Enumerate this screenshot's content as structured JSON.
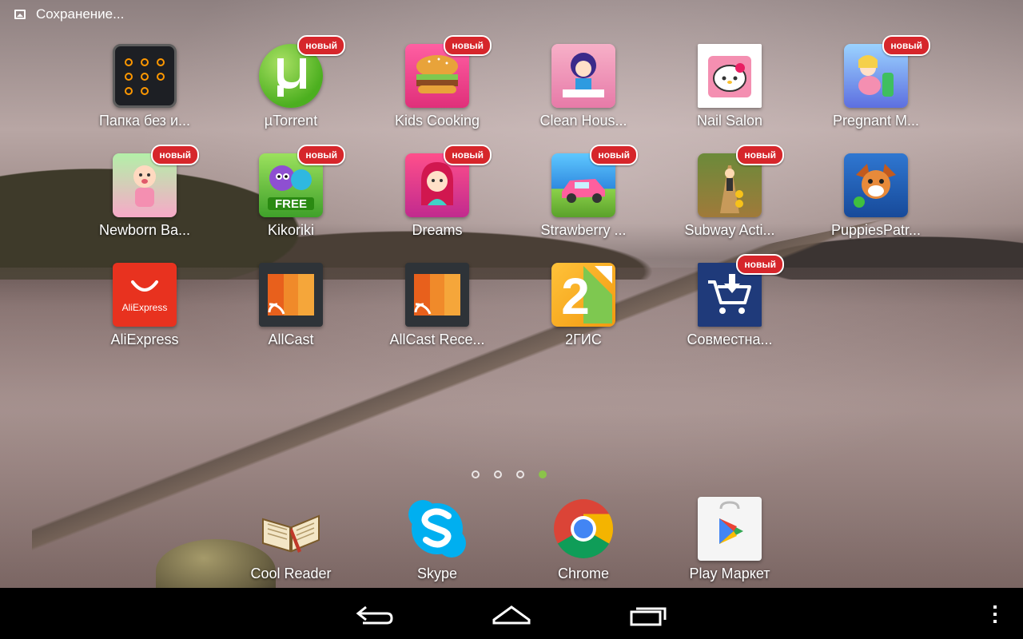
{
  "status_bar": {
    "notification_text": "Сохранение...",
    "notification_icon": "image-icon"
  },
  "badge_text": "новый",
  "apps": [
    {
      "label": "Папка без и...",
      "icon": "folder-icon",
      "badge": false
    },
    {
      "label": "µTorrent",
      "icon": "utorrent-icon",
      "badge": true
    },
    {
      "label": "Kids Cooking",
      "icon": "burger-game-icon",
      "badge": true
    },
    {
      "label": "Clean Hous...",
      "icon": "clean-house-game-icon",
      "badge": false
    },
    {
      "label": "Nail Salon",
      "icon": "hello-kitty-nail-icon",
      "badge": false
    },
    {
      "label": "Pregnant M...",
      "icon": "pregnant-game-icon",
      "badge": true
    },
    {
      "label": "Newborn Ba...",
      "icon": "newborn-baby-icon",
      "badge": true
    },
    {
      "label": "Kikoriki",
      "icon": "kikoriki-icon",
      "badge": true
    },
    {
      "label": "Dreams",
      "icon": "strawberry-dreams-icon",
      "badge": true
    },
    {
      "label": "Strawberry ...",
      "icon": "strawberry-car-icon",
      "badge": true
    },
    {
      "label": "Subway Acti...",
      "icon": "subway-runner-icon",
      "badge": true
    },
    {
      "label": "PuppiesPatr...",
      "icon": "puppy-patrol-icon",
      "badge": false
    },
    {
      "label": "AliExpress",
      "icon": "aliexpress-icon",
      "badge": false
    },
    {
      "label": "AllCast",
      "icon": "allcast-icon",
      "badge": false
    },
    {
      "label": "AllCast Rece...",
      "icon": "allcast-receiver-icon",
      "badge": false
    },
    {
      "label": "2ГИС",
      "icon": "2gis-icon",
      "badge": false
    },
    {
      "label": "Совместна...",
      "icon": "shopping-cart-icon",
      "badge": true
    }
  ],
  "icon_texts": {
    "kikoriki": "FREE",
    "aliexpress": "AliExpress",
    "twogis": "2"
  },
  "page_indicator": {
    "pages": 4,
    "current": 4
  },
  "dock": [
    {
      "label": "Cool Reader",
      "icon": "book-icon"
    },
    {
      "label": "Skype",
      "icon": "skype-icon"
    },
    {
      "label": "Chrome",
      "icon": "chrome-icon"
    },
    {
      "label": "Play Маркет",
      "icon": "play-store-icon"
    }
  ],
  "colors": {
    "badge_red": "#d6262b",
    "indicator_active": "#8bc34a",
    "nav_bg": "#000000"
  }
}
